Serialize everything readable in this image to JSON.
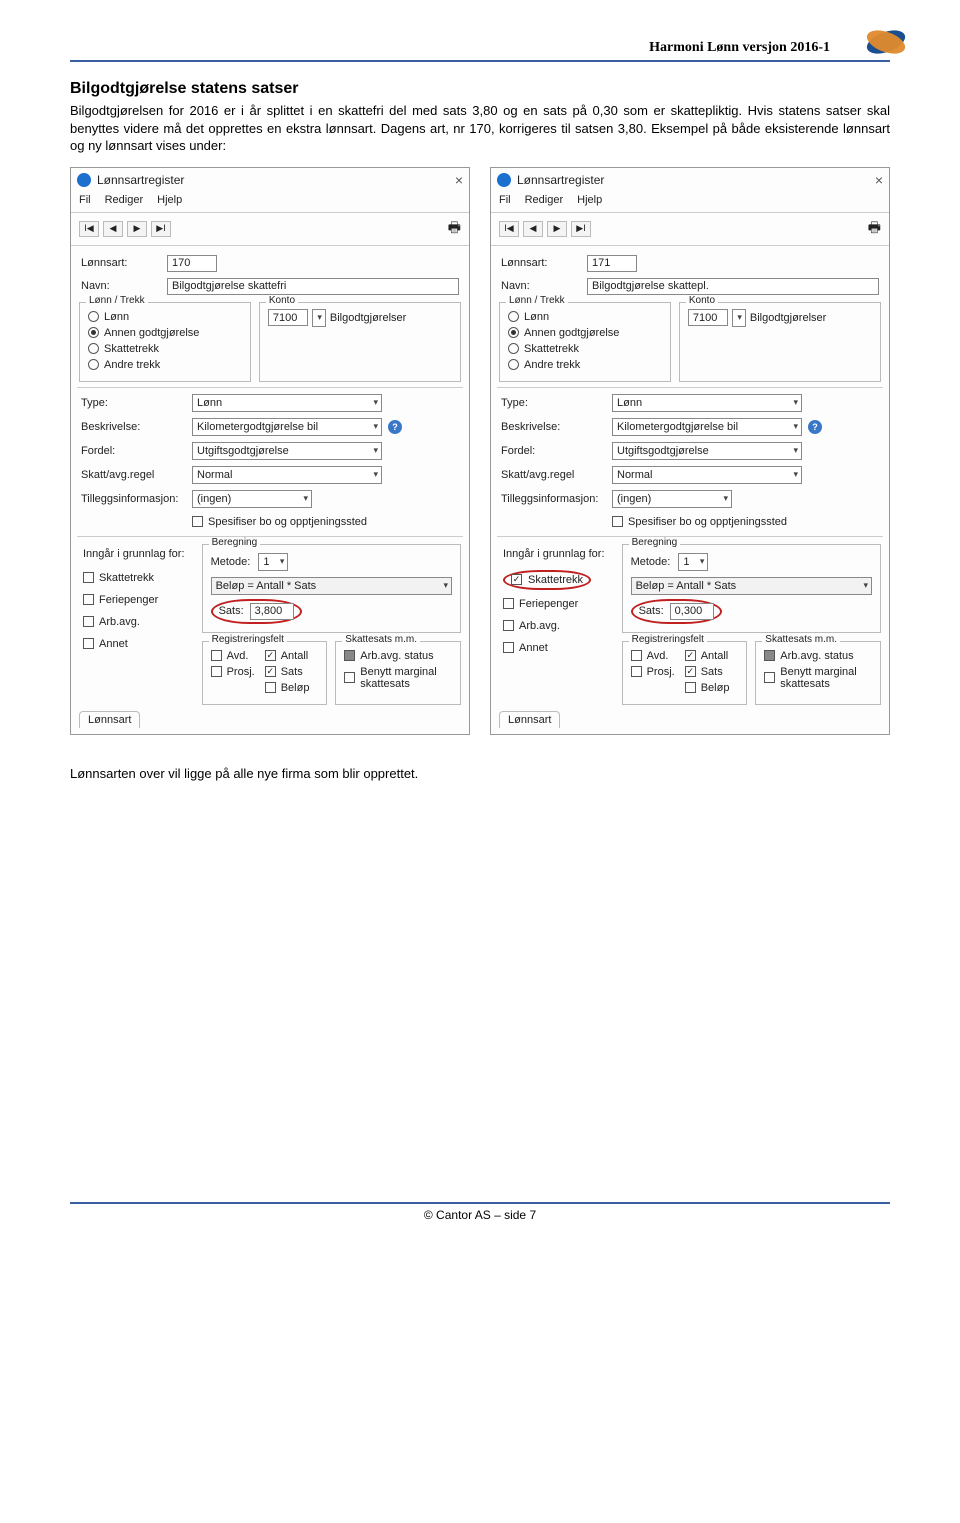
{
  "header": {
    "title": "Harmoni Lønn versjon 2016-1"
  },
  "section": {
    "heading": "Bilgodtgjørelse statens satser",
    "p1": "Bilgodtgjørelsen for 2016 er i år splittet i en skattefri del med sats 3,80 og en sats på 0,30 som er skattepliktig. Hvis statens satser skal benyttes videre må det opprettes en ekstra lønnsart. Dagens art, nr 170, korrigeres til satsen 3,80. Eksempel på både eksisterende lønnsart og ny lønnsart vises under:",
    "p2": "Lønnsarten over vil ligge på alle nye firma som blir opprettet."
  },
  "panels": [
    {
      "title": "Lønnsartregister",
      "menu": [
        "Fil",
        "Rediger",
        "Hjelp"
      ],
      "lonnArt": {
        "label": "Lønnsart:",
        "value": "170"
      },
      "navn": {
        "label": "Navn:",
        "value": "Bilgodtgjørelse skattefri"
      },
      "groupLT": {
        "title": "Lønn / Trekk",
        "opts": [
          "Lønn",
          "Annen godtgjørelse",
          "Skattetrekk",
          "Andre trekk"
        ],
        "checked": 1
      },
      "groupK": {
        "title": "Konto",
        "acct": "7100",
        "name": "Bilgodtgjørelser"
      },
      "typeRow": {
        "label": "Type:",
        "value": "Lønn"
      },
      "beskrivelse": {
        "label": "Beskrivelse:",
        "value": "Kilometergodtgjørelse bil"
      },
      "fordel": {
        "label": "Fordel:",
        "value": "Utgiftsgodtgjørelse"
      },
      "skatt": {
        "label": "Skatt/avg.regel",
        "value": "Normal"
      },
      "tillegg": {
        "label": "Tilleggsinformasjon:",
        "value": "(ingen)"
      },
      "spesifiser": "Spesifiser bo og opptjeningssted",
      "grunnlagTitle": "Inngår i grunnlag for:",
      "grunnlagOpts": [
        "Skattetrekk",
        "Feriepenger",
        "Arb.avg.",
        "Annet"
      ],
      "skattetrekkChecked": false,
      "beregning": {
        "title": "Beregning",
        "metode": "Metode:",
        "metodeVal": "1",
        "formula": "Beløp = Antall * Sats",
        "satsLbl": "Sats:",
        "satsVal": "3,800"
      },
      "regFelt": {
        "title": "Registreringsfelt",
        "items": [
          "Avd.",
          "Antall",
          "Prosj.",
          "Sats",
          "Beløp"
        ]
      },
      "skattesats": {
        "title": "Skattesats m.m.",
        "items": [
          "Arb.avg. status",
          "Benytt marginal skattesats"
        ]
      },
      "tabFoot": "Lønnsart"
    },
    {
      "title": "Lønnsartregister",
      "menu": [
        "Fil",
        "Rediger",
        "Hjelp"
      ],
      "lonnArt": {
        "label": "Lønnsart:",
        "value": "171"
      },
      "navn": {
        "label": "Navn:",
        "value": "Bilgodtgjørelse skattepl."
      },
      "groupLT": {
        "title": "Lønn / Trekk",
        "opts": [
          "Lønn",
          "Annen godtgjørelse",
          "Skattetrekk",
          "Andre trekk"
        ],
        "checked": 1
      },
      "groupK": {
        "title": "Konto",
        "acct": "7100",
        "name": "Bilgodtgjørelser"
      },
      "typeRow": {
        "label": "Type:",
        "value": "Lønn"
      },
      "beskrivelse": {
        "label": "Beskrivelse:",
        "value": "Kilometergodtgjørelse bil"
      },
      "fordel": {
        "label": "Fordel:",
        "value": "Utgiftsgodtgjørelse"
      },
      "skatt": {
        "label": "Skatt/avg.regel",
        "value": "Normal"
      },
      "tillegg": {
        "label": "Tilleggsinformasjon:",
        "value": "(ingen)"
      },
      "spesifiser": "Spesifiser bo og opptjeningssted",
      "grunnlagTitle": "Inngår i grunnlag for:",
      "grunnlagOpts": [
        "Skattetrekk",
        "Feriepenger",
        "Arb.avg.",
        "Annet"
      ],
      "skattetrekkChecked": true,
      "beregning": {
        "title": "Beregning",
        "metode": "Metode:",
        "metodeVal": "1",
        "formula": "Beløp = Antall * Sats",
        "satsLbl": "Sats:",
        "satsVal": "0,300"
      },
      "regFelt": {
        "title": "Registreringsfelt",
        "items": [
          "Avd.",
          "Antall",
          "Prosj.",
          "Sats",
          "Beløp"
        ]
      },
      "skattesats": {
        "title": "Skattesats m.m.",
        "items": [
          "Arb.avg. status",
          "Benytt marginal skattesats"
        ]
      },
      "tabFoot": "Lønnsart"
    }
  ],
  "footer": {
    "text": "© Cantor AS – side 7"
  }
}
